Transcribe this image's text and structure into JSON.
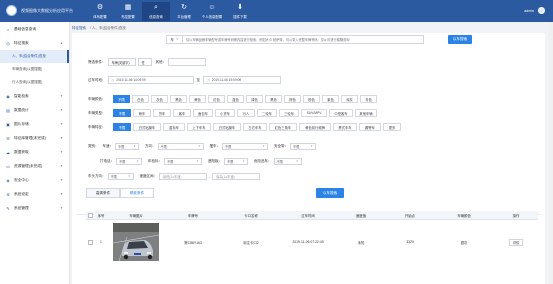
{
  "header": {
    "brand": "视频图像大数据分析应用平台",
    "nav": [
      {
        "label": "体系配置",
        "icon": "gear-icon"
      },
      {
        "label": "布控配置",
        "icon": "grid-icon"
      },
      {
        "label": "信息查询",
        "icon": "search-icon"
      },
      {
        "label": "平台管理",
        "icon": "refresh-icon"
      },
      {
        "label": "个人信息配置",
        "icon": "person-icon"
      },
      {
        "label": "插件下载",
        "icon": "download-icon"
      }
    ],
    "user": "admin"
  },
  "sidebar": {
    "items": [
      {
        "label": "基础信息查询",
        "icon": "home-icon"
      },
      {
        "label": "特征搜索",
        "icon": "target-icon",
        "sub": [
          "人、车(结合条件)查找",
          "车辆查询(以图搜图)",
          "行人查询(以图搜图)"
        ]
      },
      {
        "label": "智能检索",
        "icon": "eye-icon"
      },
      {
        "label": "数据统计",
        "icon": "chart-icon"
      },
      {
        "label": "图片存储",
        "icon": "image-icon"
      },
      {
        "label": "特征库管理(未完成)",
        "icon": "db-icon"
      },
      {
        "label": "数据获取",
        "icon": "cloud-icon"
      },
      {
        "label": "资源管理(未完成)",
        "icon": "folder-icon"
      },
      {
        "label": "安全中心",
        "icon": "shield-icon"
      },
      {
        "label": "系统设定",
        "icon": "cog-icon"
      },
      {
        "label": "系统管理",
        "icon": "wrench-icon"
      }
    ]
  },
  "breadcrumb": {
    "title": "特征搜索",
    "path": "/ 人、车(结合条件)查找"
  },
  "search": {
    "select": "车",
    "placeholder": "请以车辆品牌车辆型号或车牌号码等内容进行检索，例如大众 帕萨特，可以录入完整车牌号码：京A·可进行模糊查询",
    "button": "以车搜索"
  },
  "filters": {
    "condition_label": "筛选条件：",
    "condition_value": "车牌(关键字)",
    "condition_extra": "任",
    "other_label": "其他：",
    "time_label": "过车时段：",
    "time_start": "2019-11-06 14:09:09",
    "time_sep": "至",
    "time_end": "2019-11-06 19:09:09",
    "color_label": "车辆颜色：",
    "colors": [
      "不限",
      "白色",
      "灰色",
      "黑色",
      "黄色",
      "红色",
      "蓝色",
      "绿色",
      "黑色",
      "棕色",
      "粉色",
      "紫色",
      "深灰",
      "青色"
    ],
    "type_label": "车辆类型：",
    "types": [
      "不限",
      "轿车",
      "货车",
      "客车",
      "面包车",
      "小货车",
      "行人",
      "二轮车",
      "三轮车",
      "SUV/MPV",
      "中型客车",
      "其他车辆"
    ],
    "feature_label": "车辆特征：",
    "features": [
      "不限",
      "白式贴膜车",
      "重标车",
      "上下车车",
      "白式贴膜车",
      "左右车车",
      "红色三角车",
      "黄色前行频牌",
      "黑式车车",
      "蕃警车",
      "更多"
    ],
    "row5": {
      "brand_label": "类别：",
      "model_label": "车速：",
      "model_value": "不限",
      "dir_label": "方向：",
      "dir_value": "不限",
      "lane_label": "摆车：",
      "lane_value": "不限",
      "belt_label": "安全带：",
      "belt_value": "不限"
    },
    "row6": {
      "plate_label": "打电话：",
      "plate_value": "不限",
      "tag_label": "年检标：",
      "tag_value": "不限",
      "pendant_label": "遮阳板：",
      "pendant_value": "不限",
      "decor_label": "危险品车：",
      "decor_value": "不限"
    },
    "row7": {
      "dir_label": "车头方向：",
      "dir_value": "不限",
      "speed_label": "速度区间：",
      "speed_from": "最低(2≤车速)",
      "speed_to": "最高(1≤车速)"
    }
  },
  "tabs": [
    "高清条件",
    "精准条件"
  ],
  "search_button_2": "以车搜索",
  "table": {
    "headers": [
      "序号",
      "车辆图片",
      "车牌号",
      "卡口名称",
      "过车时间",
      "速度值",
      "开始点",
      "车辆颜色",
      "操作"
    ],
    "rows": [
      {
        "index": "1",
        "plate": "冀C88Y163",
        "checkpoint": "标注卡口2",
        "time": "2019-11-06 07:22:49",
        "speed": "未知",
        "start": "3320",
        "color": "银灰",
        "action": "详情"
      }
    ]
  },
  "colors": {
    "brand": "#2c5aa0",
    "accent": "#2c83e6"
  }
}
